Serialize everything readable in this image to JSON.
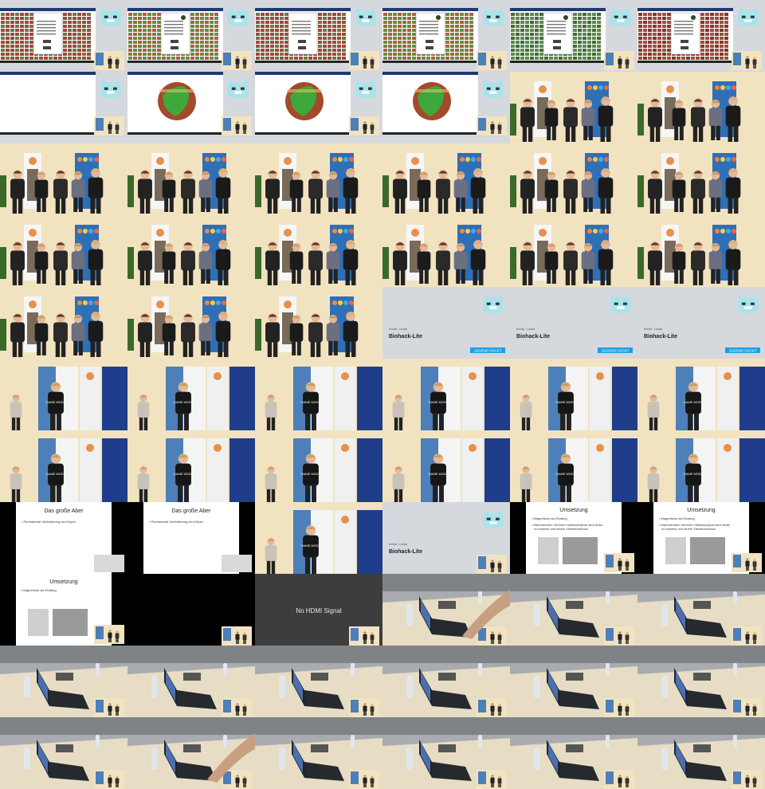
{
  "slides": {
    "sponsor_name": "ureah, Lucas",
    "talk_title": "Biohack-Lite",
    "brand_badge": "JUGEND HACKT"
  },
  "aber_slide": {
    "title": "Das große Aber",
    "bullet": "Permanente Veränderung am Körper"
  },
  "umsetzung_slide": {
    "title": "Umsetzung",
    "bullets": [
      "Magnetsinn als Einstieg",
      "Wahrnehmen mit einer Hallsonde(Aus dem Arduino Kasten) und einem Vibrationsmotor"
    ]
  },
  "no_signal": {
    "text": "No HDMI Signal"
  },
  "shirt_text": "GAME MODE",
  "colors": {
    "slide_bg": "#d5d8dc",
    "stage_wall": "#f2e3c0",
    "table": "#e7dcc4",
    "floor_grey": "#8a8d90",
    "brand_blue": "#1ea0e6",
    "black": "#000000"
  },
  "cells": [
    {
      "type": "desktop_red"
    },
    {
      "type": "desktop_green"
    },
    {
      "type": "desktop_red"
    },
    {
      "type": "desktop_green"
    },
    {
      "type": "desktop_green2"
    },
    {
      "type": "desktop_red2"
    },
    {
      "type": "white_app"
    },
    {
      "type": "globe"
    },
    {
      "type": "globe"
    },
    {
      "type": "globe"
    },
    {
      "type": "stage_wide"
    },
    {
      "type": "stage_wide"
    },
    {
      "type": "stage_wide"
    },
    {
      "type": "stage_wide"
    },
    {
      "type": "stage_wide"
    },
    {
      "type": "stage_wide"
    },
    {
      "type": "stage_wide"
    },
    {
      "type": "stage_wide"
    },
    {
      "type": "stage_wide"
    },
    {
      "type": "stage_wide"
    },
    {
      "type": "stage_wide"
    },
    {
      "type": "stage_wide"
    },
    {
      "type": "stage_wide"
    },
    {
      "type": "stage_wide"
    },
    {
      "type": "stage_wide"
    },
    {
      "type": "stage_wide"
    },
    {
      "type": "stage_wide"
    },
    {
      "type": "title"
    },
    {
      "type": "title"
    },
    {
      "type": "title"
    },
    {
      "type": "stage_two"
    },
    {
      "type": "stage_two"
    },
    {
      "type": "stage_two"
    },
    {
      "type": "stage_two"
    },
    {
      "type": "stage_two"
    },
    {
      "type": "stage_two"
    },
    {
      "type": "stage_two"
    },
    {
      "type": "stage_two"
    },
    {
      "type": "stage_two"
    },
    {
      "type": "stage_two"
    },
    {
      "type": "stage_two"
    },
    {
      "type": "stage_two"
    },
    {
      "type": "aber"
    },
    {
      "type": "aber"
    },
    {
      "type": "stage_two"
    },
    {
      "type": "title_small"
    },
    {
      "type": "umsetzung"
    },
    {
      "type": "umsetzung"
    },
    {
      "type": "umsetzung_small"
    },
    {
      "type": "black"
    },
    {
      "type": "nosignal"
    },
    {
      "type": "table_hand"
    },
    {
      "type": "table"
    },
    {
      "type": "table"
    },
    {
      "type": "table"
    },
    {
      "type": "table"
    },
    {
      "type": "table"
    },
    {
      "type": "table"
    },
    {
      "type": "table"
    },
    {
      "type": "table"
    },
    {
      "type": "table"
    },
    {
      "type": "table_hand"
    },
    {
      "type": "table"
    },
    {
      "type": "table"
    },
    {
      "type": "table"
    },
    {
      "type": "table"
    }
  ]
}
